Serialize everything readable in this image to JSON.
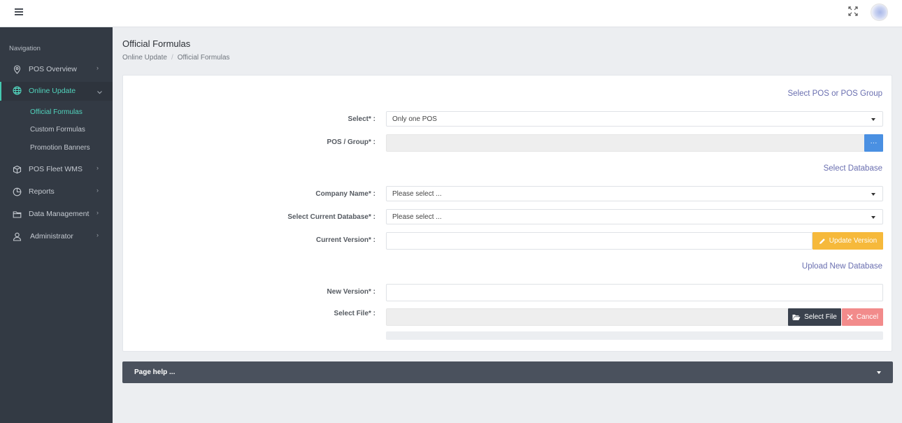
{
  "header": {
    "menu_icon": "hamburger-icon",
    "fullscreen_icon": "expand-icon",
    "avatar_icon": "avatar"
  },
  "sidebar": {
    "heading": "Navigation",
    "items": [
      {
        "label": "POS Overview",
        "icon": "map-pin-icon"
      },
      {
        "label": "Online Update",
        "icon": "globe-icon"
      },
      {
        "label": "POS Fleet WMS",
        "icon": "box-icon"
      },
      {
        "label": "Reports",
        "icon": "pie-chart-icon"
      },
      {
        "label": "Data Management",
        "icon": "folder-icon"
      },
      {
        "label": "Administrator",
        "icon": "user-icon"
      }
    ],
    "sub_items": [
      "Official Formulas",
      "Custom Formulas",
      "Promotion Banners"
    ]
  },
  "page": {
    "title": "Official Formulas",
    "breadcrumb": [
      "Online Update",
      "Official Formulas"
    ]
  },
  "form": {
    "section_pos": "Select POS or POS Group",
    "select_label": "Select* :",
    "select_value": "Only one POS",
    "pos_group_label": "POS / Group* :",
    "pos_group_button": "···",
    "section_db": "Select Database",
    "company_label": "Company Name* :",
    "company_value": "Please select ...",
    "current_db_label": "Select Current Database* :",
    "current_db_value": "Please select ...",
    "current_version_label": "Current Version* :",
    "update_version_button": "Update Version",
    "section_upload": "Upload New Database",
    "new_version_label": "New Version* :",
    "select_file_label": "Select File* :",
    "select_file_button": "Select File",
    "cancel_button": "Cancel"
  },
  "help": {
    "label": "Page help ..."
  },
  "colors": {
    "accent": "#52d4bd",
    "sidebar": "#333a44",
    "link": "#6a6fb0",
    "warning": "#f6b93b",
    "danger": "#f28b8b",
    "primary": "#4a90e2"
  }
}
